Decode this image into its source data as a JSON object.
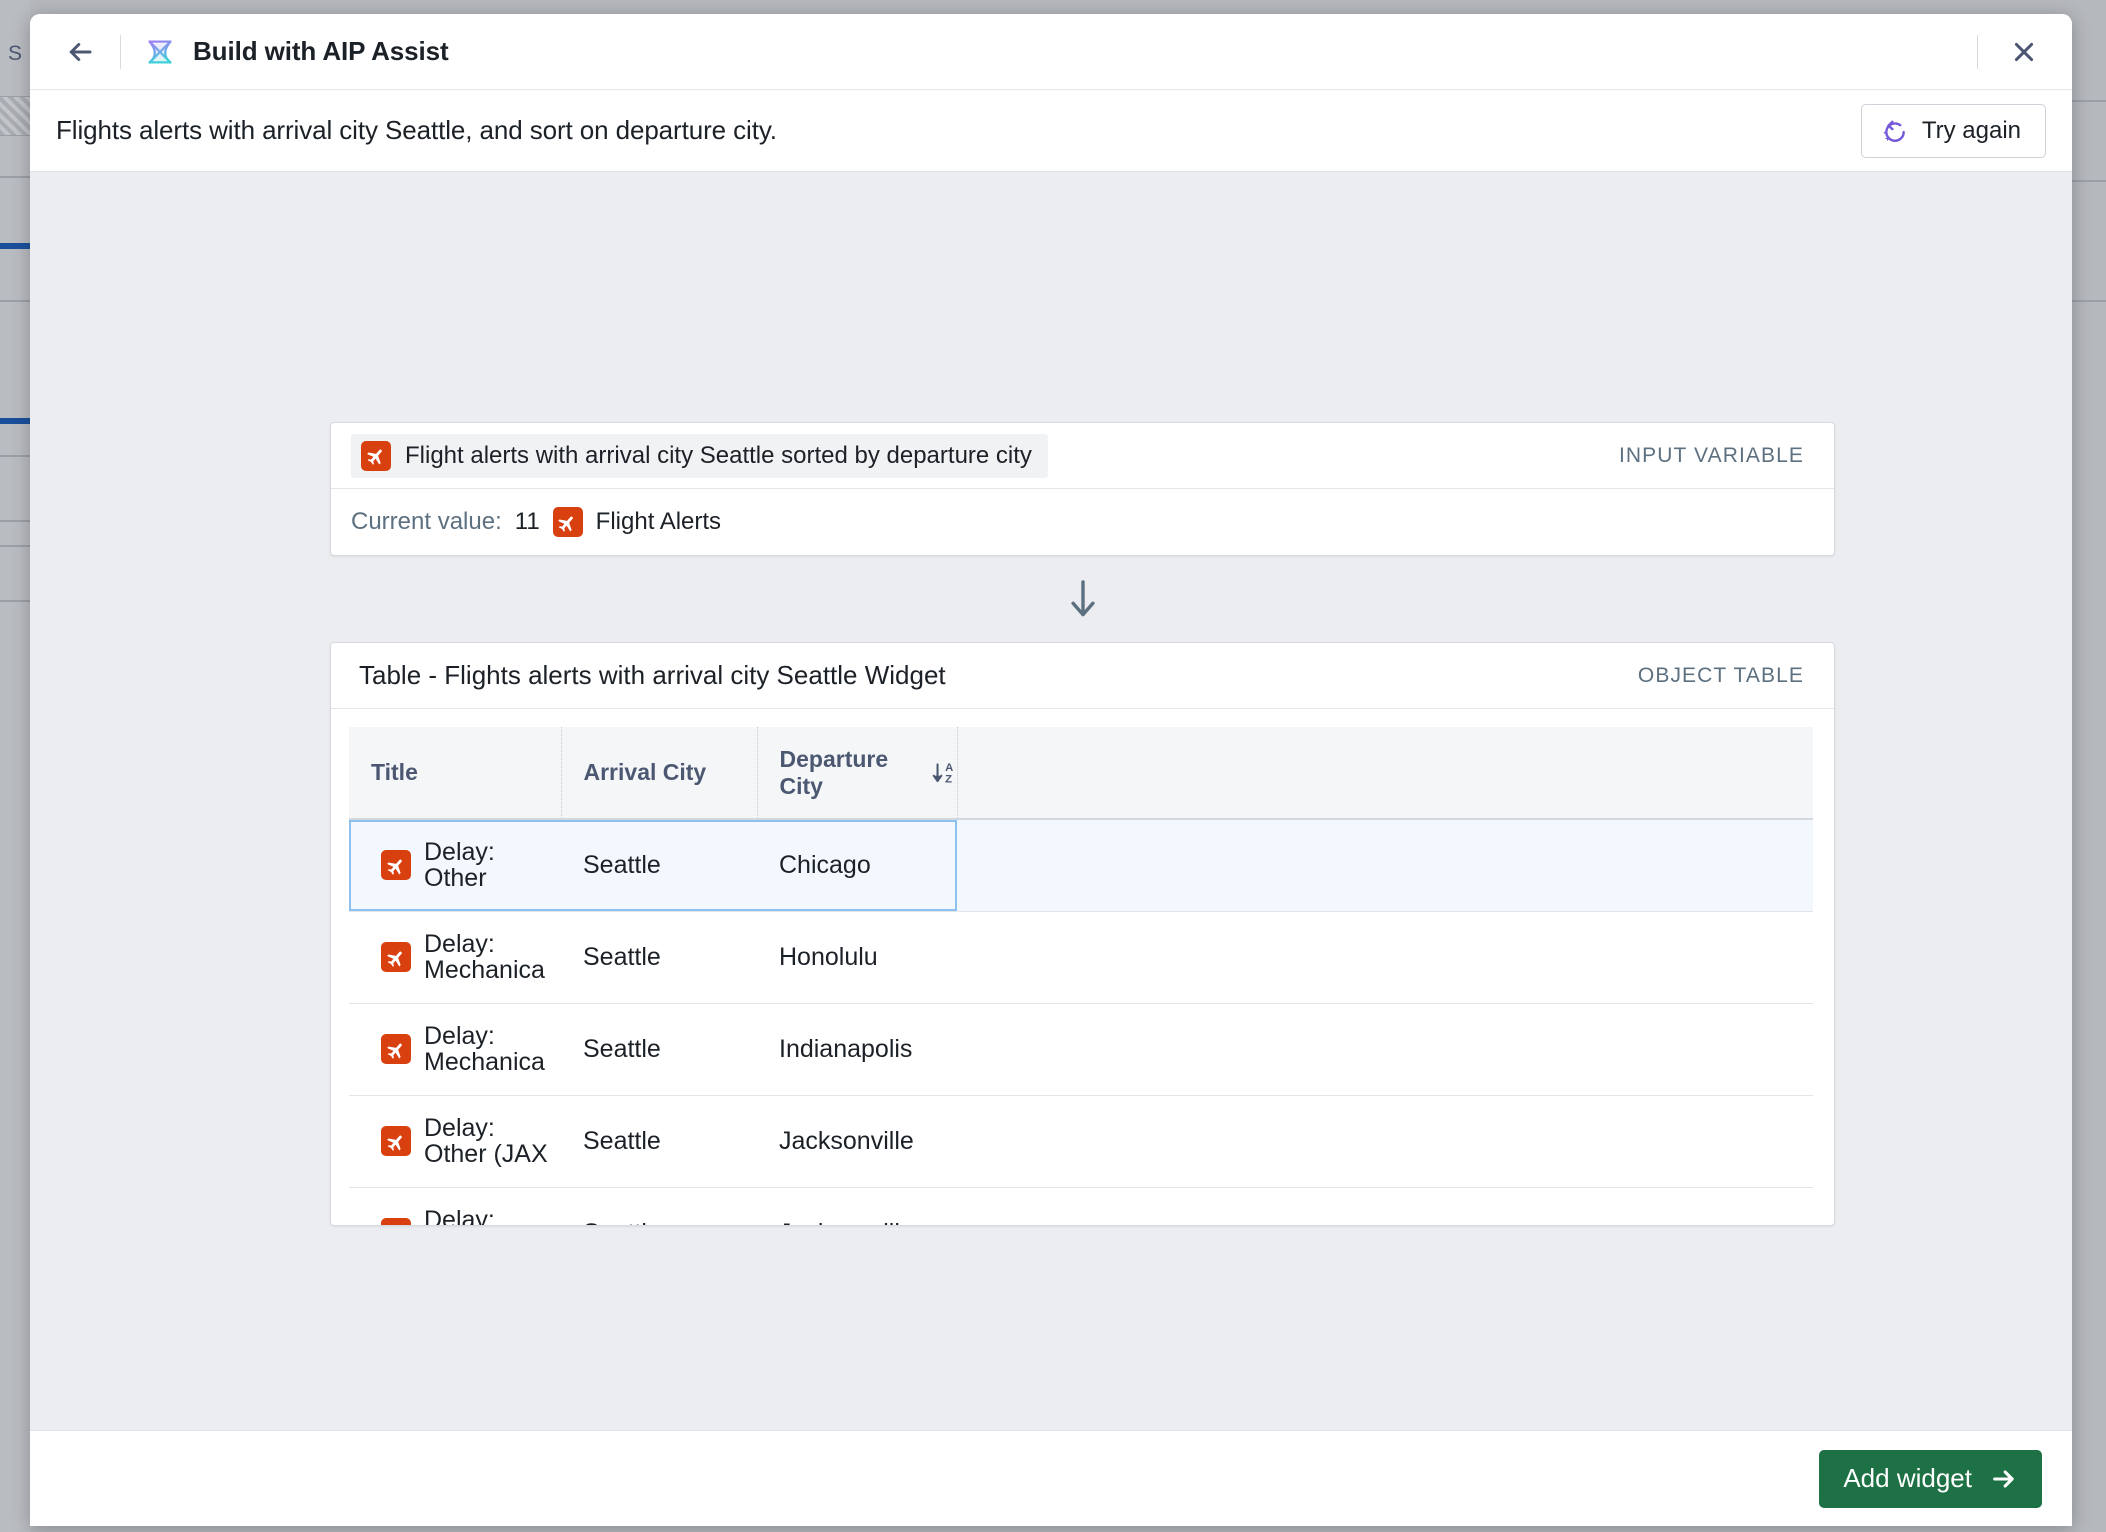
{
  "background": {
    "side_label": "S"
  },
  "header": {
    "title": "Build with AIP Assist",
    "back_icon": "arrow-left-icon",
    "logo_icon": "aip-hourglass-logo",
    "close_icon": "close-icon"
  },
  "prompt": {
    "text": "Flights alerts with arrival city Seattle, and sort on departure city.",
    "try_again_label": "Try again",
    "try_again_icon": "refresh-sparkle-icon"
  },
  "input_variable_card": {
    "kind_label": "INPUT VARIABLE",
    "chip_label": "Flight alerts with arrival city Seattle sorted by departure city",
    "chip_icon": "flight-alert-icon",
    "current_value_label": "Current value:",
    "current_value_count": "11",
    "current_value_type": "Flight Alerts",
    "current_value_icon": "flight-alert-icon"
  },
  "connector": {
    "icon": "arrow-down-icon"
  },
  "object_table_card": {
    "kind_label": "OBJECT TABLE",
    "title": "Table - Flights alerts with arrival city Seattle Widget",
    "sort_icon": "sort-az-descending-icon",
    "columns": [
      "Title",
      "Arrival City",
      "Departure City",
      ""
    ],
    "sorted_column": "Departure City",
    "rows": [
      {
        "icon": "flight-alert-icon",
        "title": "Delay: Other",
        "arrival_city": "Seattle",
        "departure_city": "Chicago",
        "selected": true
      },
      {
        "icon": "flight-alert-icon",
        "title": "Delay: Mechanica",
        "arrival_city": "Seattle",
        "departure_city": "Honolulu",
        "selected": false
      },
      {
        "icon": "flight-alert-icon",
        "title": "Delay: Mechanica",
        "arrival_city": "Seattle",
        "departure_city": "Indianapolis",
        "selected": false
      },
      {
        "icon": "flight-alert-icon",
        "title": "Delay: Other (JAX",
        "arrival_city": "Seattle",
        "departure_city": "Jacksonville",
        "selected": false
      },
      {
        "icon": "flight-alert-icon",
        "title": "Delay: Mechanica",
        "arrival_city": "Seattle",
        "departure_city": "Jacksonville",
        "selected": false
      }
    ]
  },
  "footer": {
    "add_widget_label": "Add widget",
    "add_widget_icon": "arrow-right-icon"
  },
  "colors": {
    "accent_green": "#1d7144",
    "accent_purple": "#7558d9",
    "alert_red": "#d9400f",
    "selection_blue": "#8ec0f0",
    "canvas": "#ebedf1"
  }
}
